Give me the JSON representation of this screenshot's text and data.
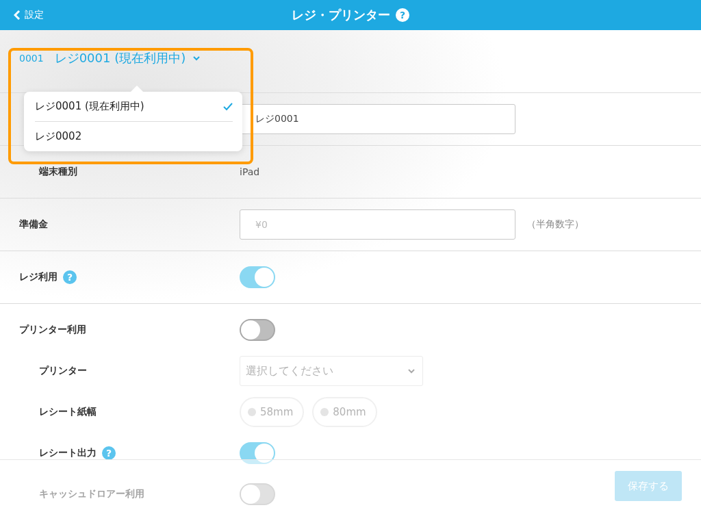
{
  "header": {
    "back": "設定",
    "title": "レジ・プリンター",
    "help": "?"
  },
  "selector": {
    "code": "0001",
    "name": "レジ0001 (現在利用中)"
  },
  "dropdown": {
    "options": [
      {
        "label": "レジ0001 (現在利用中)",
        "selected": true
      },
      {
        "label": "レジ0002",
        "selected": false
      }
    ]
  },
  "sections": [
    {
      "rows": [
        {
          "kind": "input",
          "value": "レジ0001",
          "children": [
            {
              "kind": "text",
              "label": "端末種別",
              "value": "iPad"
            }
          ]
        }
      ]
    },
    {
      "rows": [
        {
          "kind": "input",
          "label": "準備金",
          "placeholder": "¥0",
          "suffix": "（半角数字）"
        }
      ]
    },
    {
      "rows": [
        {
          "kind": "toggle",
          "label": "レジ利用",
          "help": "?",
          "on": true
        }
      ]
    },
    {
      "rows": [
        {
          "kind": "toggle",
          "label": "プリンター利用",
          "on": false,
          "children": [
            {
              "kind": "select",
              "label": "プリンター",
              "placeholder": "選択してください",
              "disabled": true
            },
            {
              "kind": "radio",
              "label": "レシート紙幅",
              "disabled": true,
              "options": [
                {
                  "label": "58mm",
                  "selected": false
                },
                {
                  "label": "80mm",
                  "selected": false
                }
              ]
            },
            {
              "kind": "toggle",
              "label": "レシート出力",
              "help": "?",
              "on": true
            },
            {
              "kind": "toggle",
              "label": "キャッシュドロアー利用",
              "on": false
            }
          ]
        }
      ]
    }
  ],
  "footer": {
    "save": "保存する",
    "disabled": true
  }
}
